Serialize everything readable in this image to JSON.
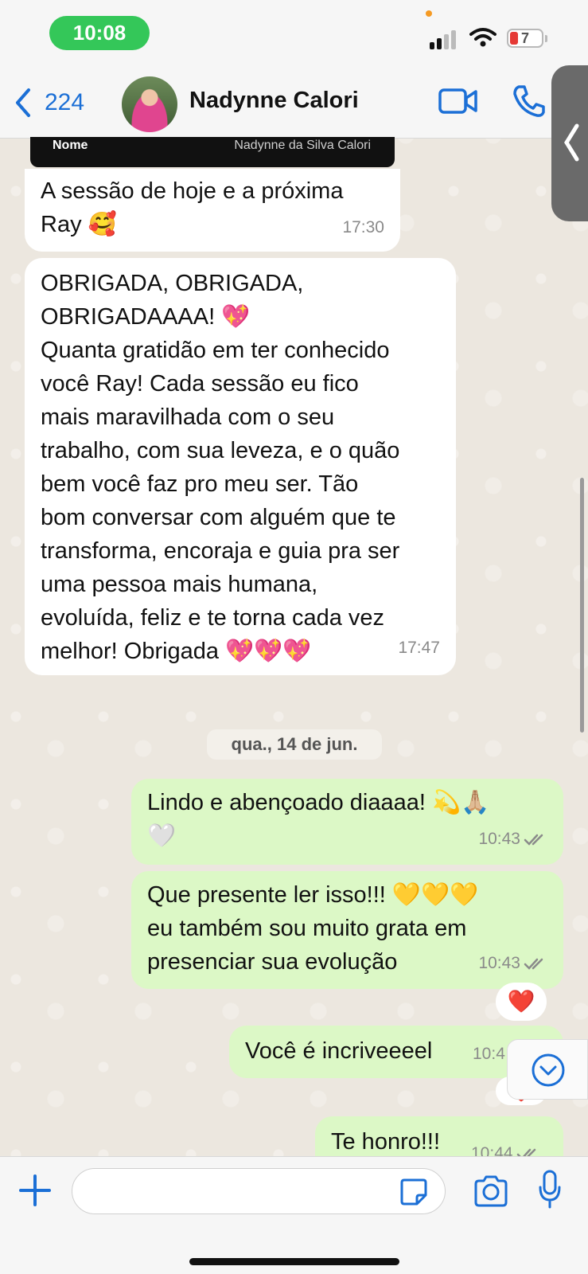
{
  "status_bar": {
    "time": "10:08",
    "battery": "7"
  },
  "header": {
    "back_count": "224",
    "contact_name": "Nadynne Calori"
  },
  "card": {
    "key": "Nome",
    "value": "Nadynne da Silva Calori"
  },
  "messages": [
    {
      "lines": [
        "A sessão de hoje e a próxima",
        "Ray 🥰"
      ],
      "time": "17:30",
      "direction": "in"
    },
    {
      "lines": [
        "OBRIGADA, OBRIGADA,",
        "OBRIGADAAAA! 💖",
        "Quanta gratidão em ter conhecido",
        "você Ray! Cada sessão eu fico",
        "mais maravilhada com o seu",
        "trabalho, com sua leveza, e o quão",
        "bem você faz pro meu ser. Tão",
        "bom conversar com alguém que te",
        "transforma, encoraja e guia pra ser",
        "uma pessoa mais humana,",
        "evoluída, feliz e te torna cada vez",
        "melhor! Obrigada 💖💖💖"
      ],
      "time": "17:47",
      "direction": "in"
    },
    {
      "lines": [
        "Lindo e abençoado diaaaa! 💫🙏🏼",
        "🤍"
      ],
      "time": "10:43",
      "direction": "out"
    },
    {
      "lines": [
        "Que presente ler isso!!! 💛💛💛",
        "eu também sou muito grata em",
        "presenciar sua evolução"
      ],
      "time": "10:43",
      "direction": "out",
      "reaction": "❤️"
    },
    {
      "lines": [
        "Você é incriveeeel"
      ],
      "time": "10:4",
      "direction": "out",
      "reaction": "❤️"
    },
    {
      "lines": [
        "Te honro!!!"
      ],
      "time": "10:44",
      "direction": "out"
    }
  ],
  "date_separator": "qua., 14 de jun.",
  "colors": {
    "accent": "#1a73e8",
    "outgoing": "#dcf8c6",
    "incoming": "#ffffff",
    "time_pill": "#34c759"
  }
}
